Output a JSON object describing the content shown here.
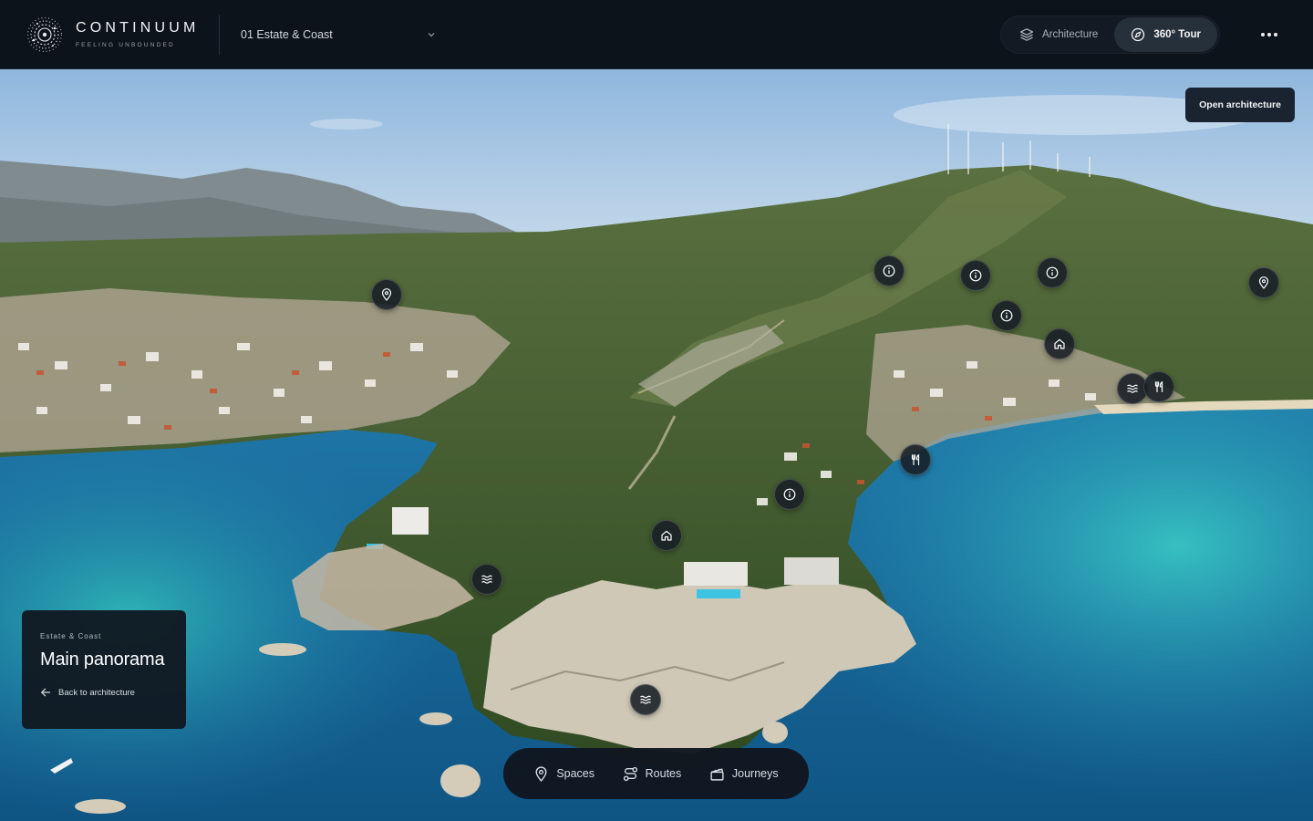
{
  "brand": {
    "name": "CONTINUUM",
    "tagline": "FEELING UNBOUNDED"
  },
  "scene_selector": {
    "value": "01 Estate & Coast"
  },
  "view_toggle": [
    {
      "label": "Architecture",
      "icon": "layers-icon",
      "active": false
    },
    {
      "label": "360° Tour",
      "icon": "compass-icon",
      "active": true
    }
  ],
  "more_menu": {
    "icon": "more-horizontal-icon"
  },
  "open_architecture_label": "Open architecture",
  "info_card": {
    "eyebrow": "Estate & Coast",
    "title": "Main panorama",
    "back_label": "Back to architecture"
  },
  "bottom_nav": [
    {
      "label": "Spaces",
      "icon": "map-pin-icon"
    },
    {
      "label": "Routes",
      "icon": "route-icon"
    },
    {
      "label": "Journeys",
      "icon": "clapper-icon"
    }
  ],
  "hotspots": [
    {
      "type": "location",
      "icon": "map-pin-icon"
    },
    {
      "type": "info",
      "icon": "info-icon"
    },
    {
      "type": "info",
      "icon": "info-icon"
    },
    {
      "type": "info",
      "icon": "info-icon"
    },
    {
      "type": "info",
      "icon": "info-icon"
    },
    {
      "type": "location",
      "icon": "map-pin-icon"
    },
    {
      "type": "home",
      "icon": "home-icon"
    },
    {
      "type": "beach",
      "icon": "waves-icon"
    },
    {
      "type": "restaurant",
      "icon": "fork-knife-icon"
    },
    {
      "type": "restaurant",
      "icon": "fork-knife-icon"
    },
    {
      "type": "info",
      "icon": "info-icon"
    },
    {
      "type": "home",
      "icon": "home-icon"
    },
    {
      "type": "beach",
      "icon": "waves-icon"
    },
    {
      "type": "beach",
      "icon": "waves-icon"
    }
  ],
  "colors": {
    "topbar": "#0d131b",
    "panel": "#101620",
    "sea_deep": "#1d6fa3",
    "sea_shallow": "#2fb5b8",
    "hill_green": "#3f5f2e",
    "sky": "#a9c9e6"
  }
}
